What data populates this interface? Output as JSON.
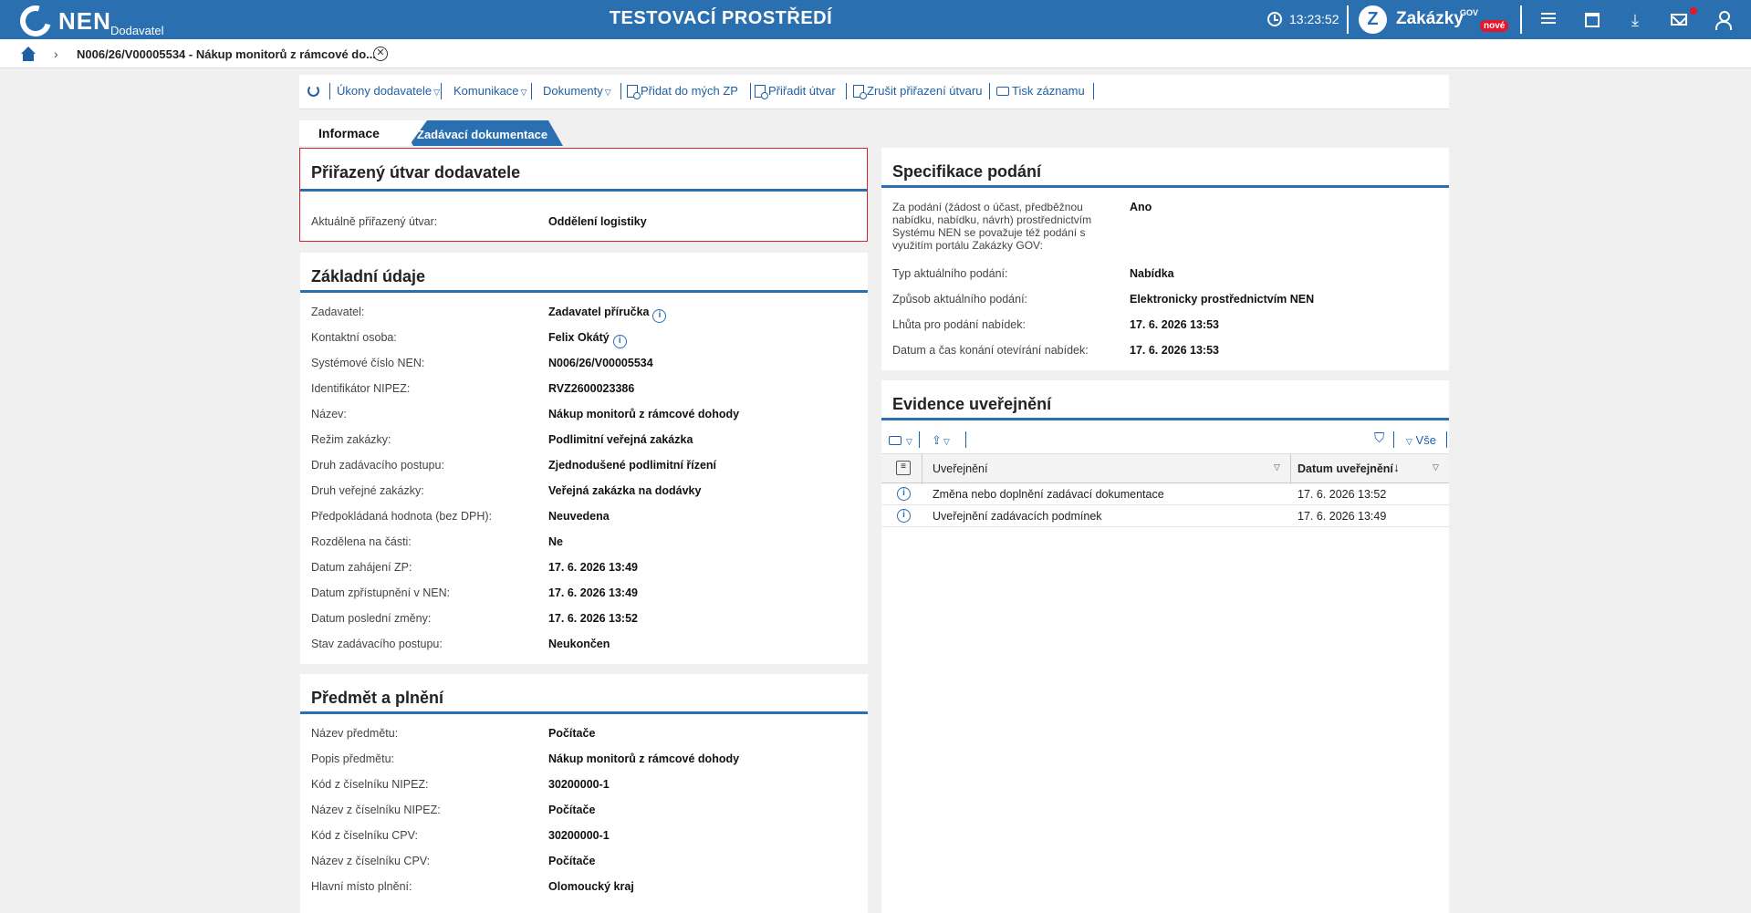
{
  "header": {
    "logo_text": "NEN",
    "logo_sub": "Dodavatel",
    "env_title": "TESTOVACÍ PROSTŘEDÍ",
    "clock": "13:23:52",
    "zk_logo": "Z",
    "zakazky": "Zakázky",
    "gov": "GOV",
    "nove": "nové",
    "icons": [
      "clock-icon",
      "menu-icon",
      "calendar-icon",
      "download-icon",
      "mail-icon",
      "user-icon"
    ]
  },
  "breadcrumb": {
    "current": "N006/26/V00005534 - Nákup monitorů z rámcové do...",
    "close": "✕"
  },
  "toolbar": {
    "ukony": "Úkony dodavatele",
    "komunikace": "Komunikace",
    "dokumenty": "Dokumenty",
    "pridat": "Přidat do mých ZP",
    "priradit": "Přiřadit útvar",
    "zrusit": "Zrušit přiřazení útvaru",
    "tisk": "Tisk záznamu"
  },
  "tabs": {
    "informace": "Informace",
    "zadavaci": "Zadávací dokumentace"
  },
  "utvar": {
    "title": "Přiřazený útvar dodavatele",
    "label": "Aktuálně přiřazený útvar:",
    "value": "Oddělení logistiky"
  },
  "zakladni": {
    "title": "Základní údaje",
    "rows": [
      {
        "label": "Zadavatel:",
        "value": "Zadavatel příručka"
      },
      {
        "label": "Kontaktní osoba:",
        "value": "Felix Okátý"
      },
      {
        "label": "Systémové číslo NEN:",
        "value": "N006/26/V00005534"
      },
      {
        "label": "Identifikátor NIPEZ:",
        "value": "RVZ2600023386"
      },
      {
        "label": "Název:",
        "value": "Nákup monitorů z rámcové dohody"
      },
      {
        "label": "Režim zakázky:",
        "value": "Podlimitní veřejná zakázka"
      },
      {
        "label": "Druh zadávacího postupu:",
        "value": "Zjednodušené podlimitní řízení"
      },
      {
        "label": "Druh veřejné zakázky:",
        "value": "Veřejná zakázka na dodávky"
      },
      {
        "label": "Předpokládaná hodnota (bez DPH):",
        "value": "Neuvedena"
      },
      {
        "label": "Rozdělena na části:",
        "value": "Ne"
      },
      {
        "label": "Datum zahájení ZP:",
        "value": "17. 6. 2026 13:49"
      },
      {
        "label": "Datum zpřístupnění v NEN:",
        "value": "17. 6. 2026 13:49"
      },
      {
        "label": "Datum poslední změny:",
        "value": "17. 6. 2026 13:52"
      },
      {
        "label": "Stav zadávacího postupu:",
        "value": "Neukončen"
      }
    ]
  },
  "predmet": {
    "title": "Předmět a plnění",
    "rows": [
      {
        "label": "Název předmětu:",
        "value": "Počítače"
      },
      {
        "label": "Popis předmětu:",
        "value": "Nákup monitorů z rámcové dohody"
      },
      {
        "label": "Kód z číselníku NIPEZ:",
        "value": "30200000-1"
      },
      {
        "label": "Název z číselníku NIPEZ:",
        "value": "Počítače"
      },
      {
        "label": "Kód z číselníku CPV:",
        "value": "30200000-1"
      },
      {
        "label": "Název z číselníku CPV:",
        "value": "Počítače"
      },
      {
        "label": "Hlavní místo plnění:",
        "value": "Olomoucký kraj"
      }
    ]
  },
  "specifikace": {
    "title": "Specifikace podání",
    "rows": [
      {
        "label": "Za podání (žádost o účast, předběžnou nabídku, nabídku, návrh) prostřednictvím Systému NEN se považuje též podání s využitím portálu Zakázky GOV:",
        "value": "Ano"
      },
      {
        "label": "Typ aktuálního podání:",
        "value": "Nabídka"
      },
      {
        "label": "Způsob aktuálního podání:",
        "value": "Elektronicky prostřednictvím NEN"
      },
      {
        "label": "Lhůta pro podání nabídek:",
        "value": "17. 6. 2026 13:53"
      },
      {
        "label": "Datum a čas konání otevírání nabídek:",
        "value": "17. 6. 2026 13:53"
      }
    ]
  },
  "evidence": {
    "title": "Evidence uveřejnění",
    "filter_all": "Vše",
    "col_uverejneni": "Uveřejnění",
    "col_datum": "Datum uveřejnění",
    "rows": [
      {
        "name": "Změna nebo doplnění zadávací dokumentace",
        "date": "17. 6. 2026 13:52"
      },
      {
        "name": "Uveřejnění zadávacích podmínek",
        "date": "17. 6. 2026 13:49"
      }
    ]
  }
}
